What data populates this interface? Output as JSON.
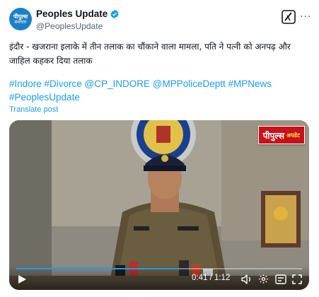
{
  "author": {
    "avatar_line1": "पीपुल्स",
    "avatar_line2": "समाचार",
    "name": "Peoples Update",
    "handle": "@PeoplesUpdate"
  },
  "tweet": {
    "text": "इंदौर - खजराना इलाके में तीन तलाक का चौंकाने वाला मामला, पति ने पत्नी को अनपढ़ और जाहिल कहकर दिया तलाक",
    "hashtags_line1": "#Indore #Divorce @CP_INDORE @MPPoliceDeptt #MPNews",
    "hashtags_line2": "#PeoplesUpdate",
    "translate_label": "Translate post"
  },
  "video": {
    "badge_main": "पीपुल्स",
    "badge_sub": "अपडेट",
    "time_display": "0:41 / 1:12",
    "progress_fraction": 0.569
  },
  "colors": {
    "link_blue": "#1d9bf0",
    "verified_blue": "#1d9bf0",
    "badge_red": "#c8111a"
  },
  "icons": [
    "verified-badge-icon",
    "grok-icon",
    "more-icon",
    "play-icon",
    "volume-icon",
    "settings-icon",
    "captions-icon",
    "fullscreen-icon"
  ]
}
